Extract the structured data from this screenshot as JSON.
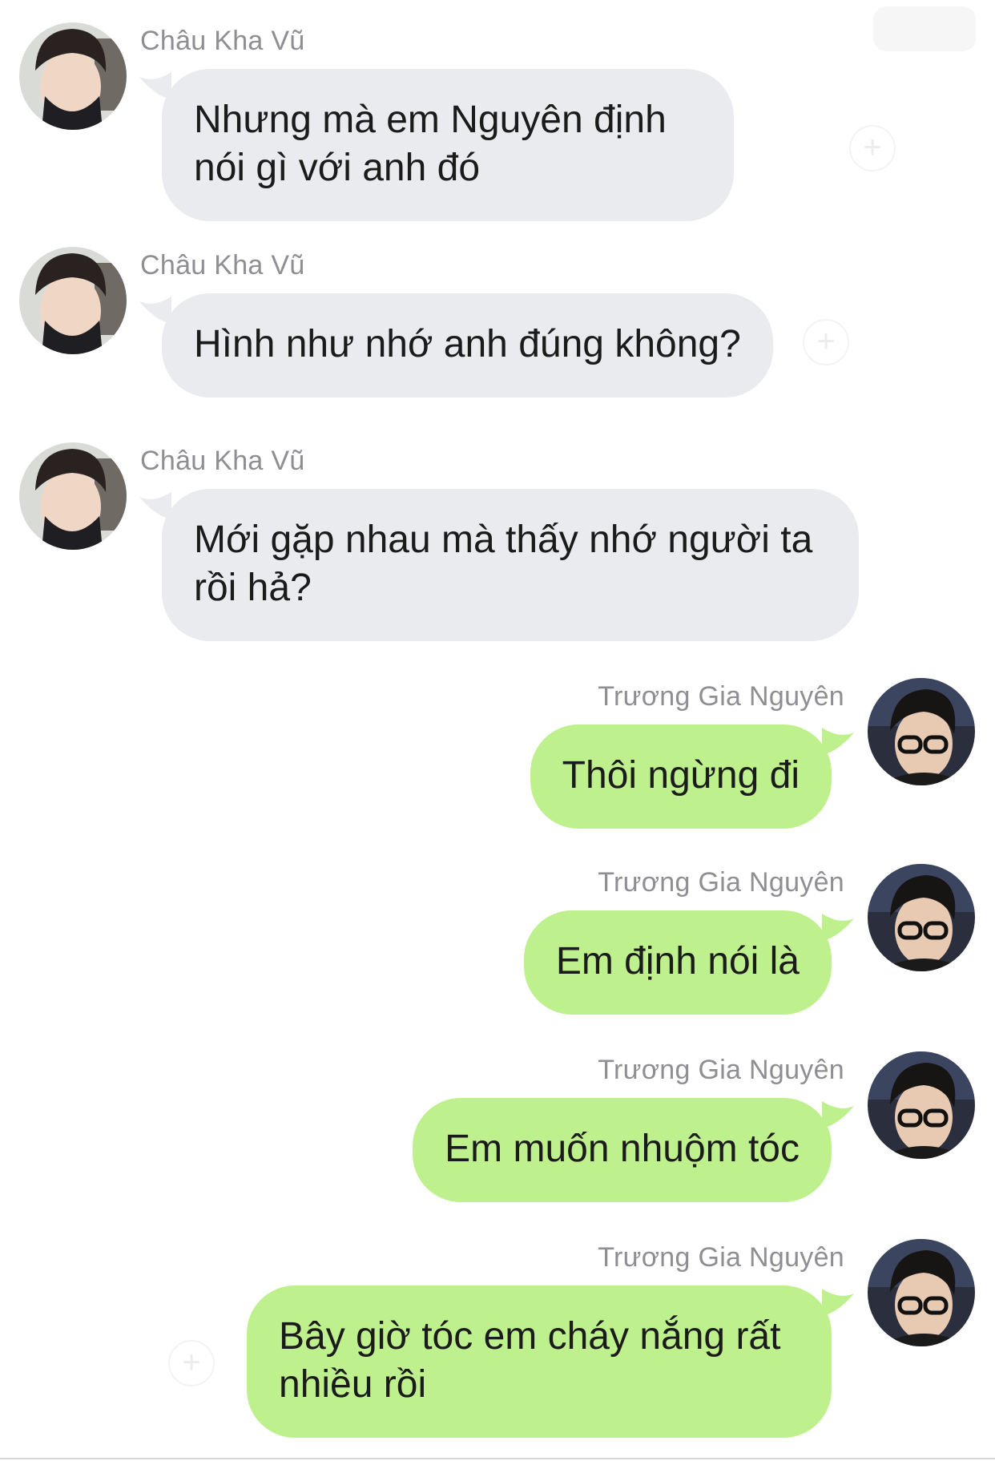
{
  "colors": {
    "incoming_bubble": "#e9ebee",
    "outgoing_bubble": "#bff08e",
    "sender_name": "#8e8e93",
    "message_text": "#1b1b1b"
  },
  "contacts": {
    "incoming": "Châu Kha Vũ",
    "outgoing": "Trương Gia Nguyên"
  },
  "messages": [
    {
      "sender": "Châu Kha Vũ",
      "text": "Nhưng mà em Nguyên định nói gì với anh đó",
      "direction": "incoming"
    },
    {
      "sender": "Châu Kha Vũ",
      "text": "Hình như nhớ anh đúng không?",
      "direction": "incoming"
    },
    {
      "sender": "Châu Kha Vũ",
      "text": "Mới gặp nhau mà thấy nhớ người ta rồi hả?",
      "direction": "incoming"
    },
    {
      "sender": "Trương Gia Nguyên",
      "text": "Thôi ngừng đi",
      "direction": "outgoing"
    },
    {
      "sender": "Trương Gia Nguyên",
      "text": "Em định nói là",
      "direction": "outgoing"
    },
    {
      "sender": "Trương Gia Nguyên",
      "text": "Em muốn nhuộm tóc",
      "direction": "outgoing"
    },
    {
      "sender": "Trương Gia Nguyên",
      "text": "Bây giờ tóc em cháy nắng rất nhiều rồi",
      "direction": "outgoing"
    }
  ],
  "icons": {
    "reaction": "add-reaction-icon",
    "incoming_avatar": "avatar-icon",
    "outgoing_avatar": "avatar-icon"
  }
}
